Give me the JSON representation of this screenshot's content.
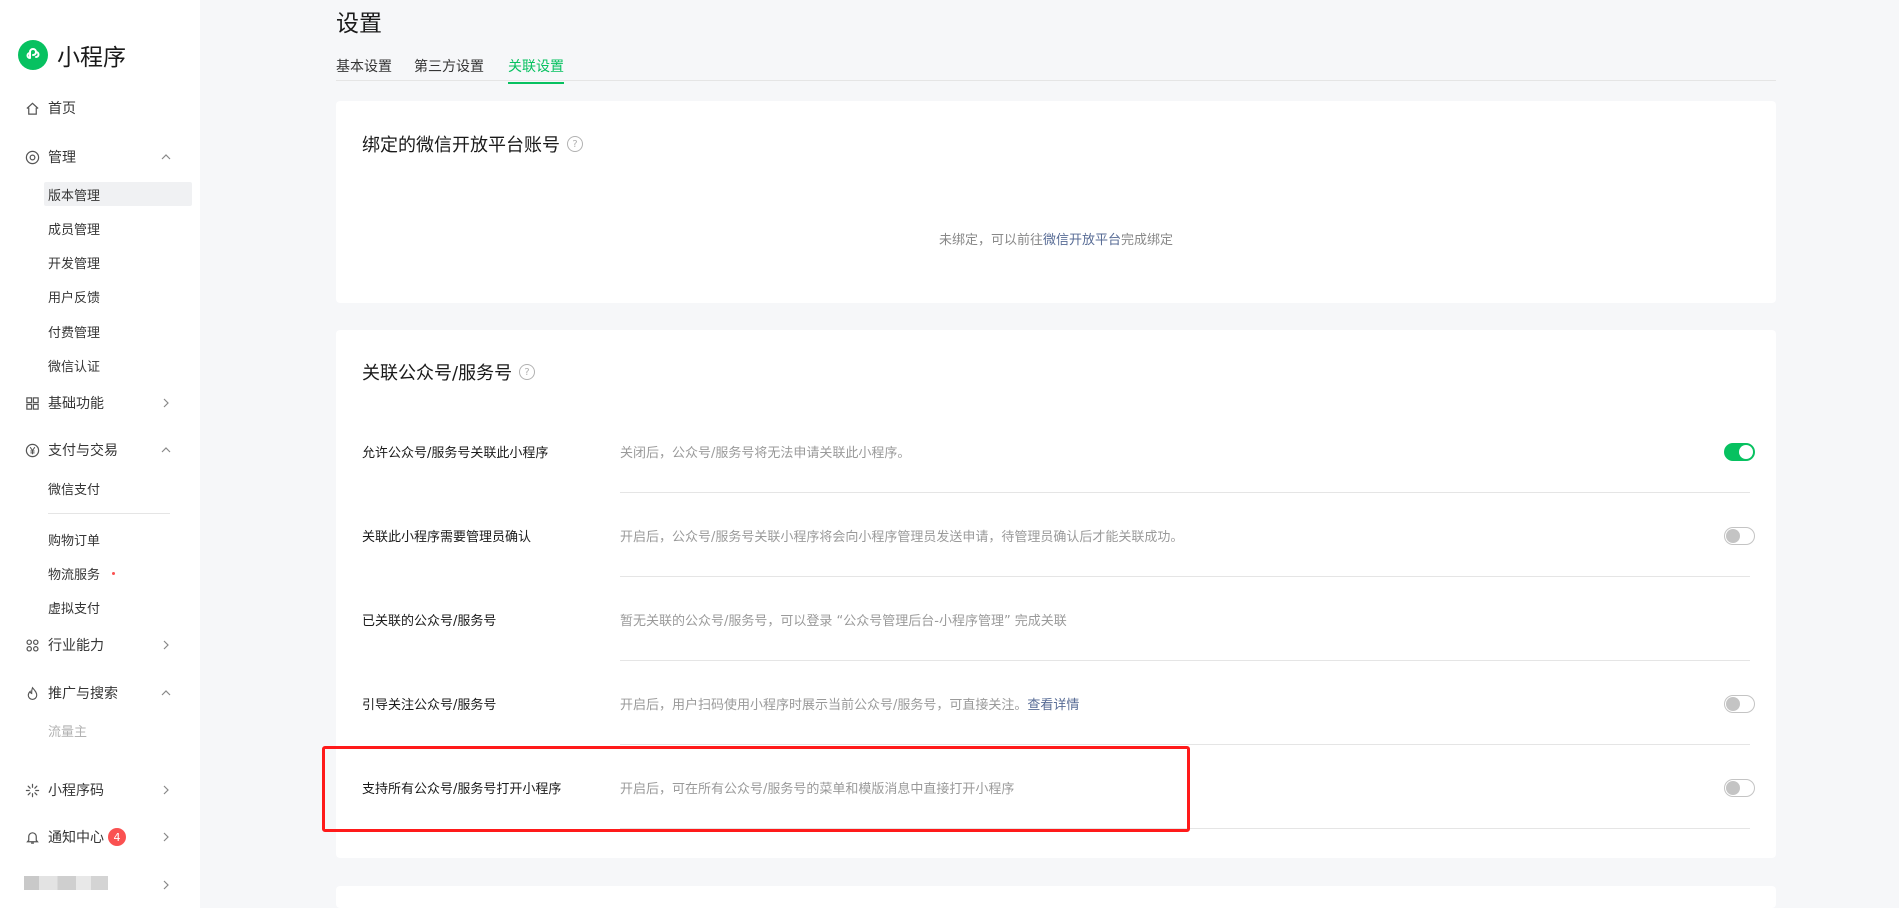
{
  "app": {
    "name": "小程序"
  },
  "sidebar": {
    "home": "首页",
    "manage": {
      "label": "管理",
      "items": [
        "版本管理",
        "成员管理",
        "开发管理",
        "用户反馈",
        "付费管理",
        "微信认证"
      ]
    },
    "basic": "基础功能",
    "payment": {
      "label": "支付与交易",
      "items": [
        "微信支付",
        "购物订单",
        "物流服务",
        "虚拟支付"
      ]
    },
    "industry": "行业能力",
    "promotion": {
      "label": "推广与搜索",
      "items": [
        "流量主"
      ]
    },
    "qrcode": "小程序码",
    "notifications": {
      "label": "通知中心",
      "count": "4"
    }
  },
  "page": {
    "title": "设置",
    "tabs": [
      "基本设置",
      "第三方设置",
      "关联设置"
    ],
    "active_tab": "关联设置"
  },
  "open_platform": {
    "title": "绑定的微信开放平台账号",
    "empty_prefix": "未绑定，可以前往",
    "empty_link": "微信开放平台",
    "empty_suffix": "完成绑定"
  },
  "oa_section": {
    "title": "关联公众号/服务号",
    "rows": [
      {
        "label": "允许公众号/服务号关联此小程序",
        "desc": "关闭后，公众号/服务号将无法申请关联此小程序。",
        "toggle": "on"
      },
      {
        "label": "关联此小程序需要管理员确认",
        "desc": "开启后，公众号/服务号关联小程序将会向小程序管理员发送申请，待管理员确认后才能关联成功。",
        "toggle": "off"
      },
      {
        "label": "已关联的公众号/服务号",
        "desc": "暂无关联的公众号/服务号，可以登录 “公众号管理后台-小程序管理” 完成关联"
      },
      {
        "label": "引导关注公众号/服务号",
        "desc": "开启后，用户扫码使用小程序时展示当前公众号/服务号，可直接关注。",
        "link": "查看详情",
        "toggle": "off"
      },
      {
        "label": "支持所有公众号/服务号打开小程序",
        "desc": "开启后，可在所有公众号/服务号的菜单和模版消息中直接打开小程序",
        "toggle": "off"
      }
    ]
  },
  "colors": {
    "brand": "#07c160",
    "link": "#576b95",
    "highlight": "#ff1a1a",
    "badge": "#fa5151"
  }
}
